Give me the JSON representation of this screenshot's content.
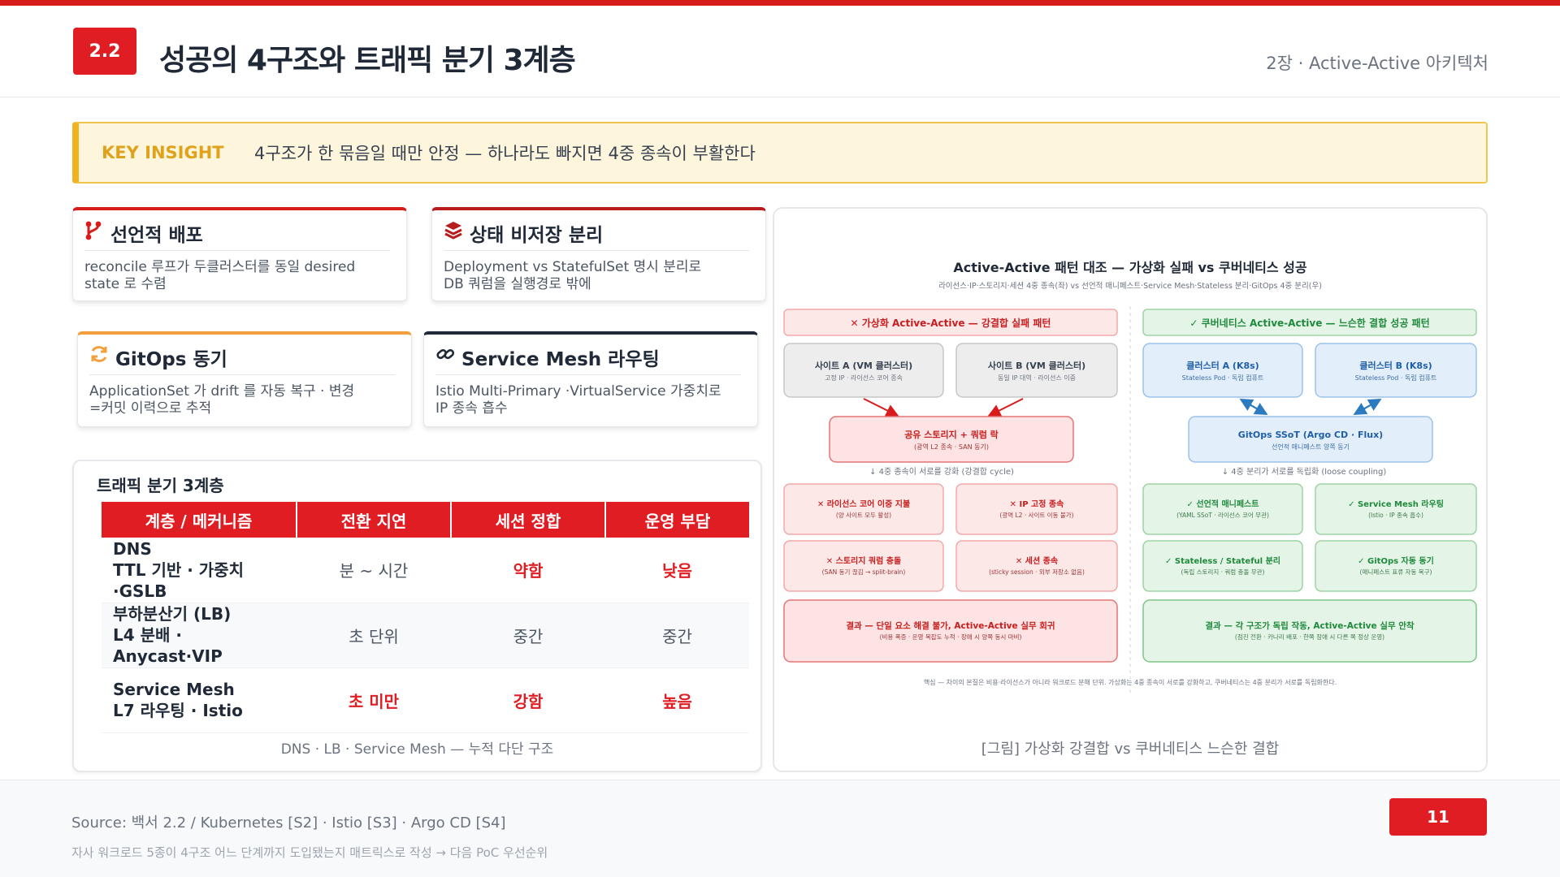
{
  "header": {
    "badge": "2.2",
    "title": "성공의 4구조와 트래픽 분기 3계층",
    "chapter": "2장 · Active-Active 아키텍처"
  },
  "insight": {
    "label": "KEY INSIGHT",
    "text": "4구조가 한 묶음일 때만 안정 — 하나라도 빠지면 4중 종속이 부활한다"
  },
  "cards": [
    {
      "title": "선언적 배포",
      "icon": "branch-icon",
      "accent": "#d81b1b",
      "lines": [
        "reconcile 루프가 두클러스터를 동일 desired",
        "state 로 수렴"
      ]
    },
    {
      "title": "상태 비저장 분리",
      "icon": "layers-icon",
      "accent": "#b91c1c",
      "lines": [
        "Deployment vs StatefulSet 명시 분리로",
        "DB 쿼럼을 실행경로 밖에"
      ]
    },
    {
      "title": "GitOps 동기",
      "icon": "sync-icon",
      "accent": "#f2a03d",
      "lines": [
        "ApplicationSet 가 drift 를 자동 복구 · 변경",
        "=커밋 이력으로 추적"
      ]
    },
    {
      "title": "Service Mesh 라우팅",
      "icon": "link-icon",
      "accent": "#1f2937",
      "lines": [
        "Istio Multi-Primary ·VirtualService 가중치로",
        "IP 종속 흡수"
      ]
    }
  ],
  "traffic": {
    "title": "트래픽 분기 3계층",
    "headers": [
      "계층 / 메커니즘",
      "전환 지연",
      "세션 정합",
      "운영 부담"
    ],
    "rows": [
      {
        "mech1": "DNS",
        "mech2": "TTL 기반 · 가중치·GSLB",
        "latency": "분 ~ 시간",
        "session": "약함",
        "burden": "낮음",
        "hl": [
          false,
          true,
          true
        ]
      },
      {
        "mech1": "부하분산기 (LB)",
        "mech2": "L4 분배 · Anycast·VIP",
        "latency": "초 단위",
        "session": "중간",
        "burden": "중간",
        "hl": [
          false,
          false,
          false
        ]
      },
      {
        "mech1": "Service Mesh",
        "mech2": "L7 라우팅 · Istio",
        "latency": "초 미만",
        "session": "강함",
        "burden": "높음",
        "hl": [
          true,
          true,
          true
        ]
      }
    ],
    "caption": "DNS · LB · Service Mesh — 누적 다단 구조"
  },
  "figure": {
    "title": "Active-Active 패턴 대조 — 가상화 실패 vs 쿠버네티스 성공",
    "subtitle": "라이선스·IP·스토리지·세션 4중 종속(좌) vs 선언적 매니페스트·Service Mesh·Stateless 분리·GitOps 4중 분리(우)",
    "left": {
      "header": "✕ 가상화 Active-Active — 강결합 실패 패턴",
      "site_a": {
        "t": "사이트 A (VM 클러스터)",
        "s": "고정 IP · 라이선스 코어 종속"
      },
      "site_b": {
        "t": "사이트 B (VM 클러스터)",
        "s": "동일 IP 대역 · 라이선스 이중"
      },
      "shared": {
        "t": "공유 스토리지 + 쿼럼 락",
        "s": "(광역 L2 종속 · SAN 동기)"
      },
      "note": "↓ 4중 종속이 서로를 강화 (강결합 cycle)",
      "items": [
        {
          "t": "✕ 라이선스 코어 이중 지불",
          "s": "(양 사이트 모두 활성)"
        },
        {
          "t": "✕ IP 고정 종속",
          "s": "(광역 L2 · 사이트 이동 불가)"
        },
        {
          "t": "✕ 스토리지 쿼럼 충돌",
          "s": "(SAN 동기 끊김 → split-brain)"
        },
        {
          "t": "✕ 세션 종속",
          "s": "(sticky session · 외부 저장소 없음)"
        }
      ],
      "result": {
        "t": "결과 — 단일 요소 해결 불가, Active-Active 실무 회귀",
        "s": "(비용 폭증 · 운영 복잡도 누적 · 장애 시 양쪽 동시 마비)"
      }
    },
    "right": {
      "header": "✓ 쿠버네티스 Active-Active — 느슨한 결합 성공 패턴",
      "site_a": {
        "t": "클러스터 A (K8s)",
        "s": "Stateless Pod · 독립 컴퓨트"
      },
      "site_b": {
        "t": "클러스터 B (K8s)",
        "s": "Stateless Pod · 독립 컴퓨트"
      },
      "shared": {
        "t": "GitOps SSoT (Argo CD · Flux)",
        "s": "선언적 매니페스트 양쪽 동기"
      },
      "note": "↓ 4중 분리가 서로를 독립화 (loose coupling)",
      "items": [
        {
          "t": "✓ 선언적 매니페스트",
          "s": "(YAML SSoT · 라이선스 코어 무관)"
        },
        {
          "t": "✓ Service Mesh 라우팅",
          "s": "(Istio · IP 종속 흡수)"
        },
        {
          "t": "✓ Stateless / Stateful 분리",
          "s": "(독립 스토리지 · 쿼럼 충돌 무관)"
        },
        {
          "t": "✓ GitOps 자동 동기",
          "s": "(매니페스트 표류 자동 복구)"
        }
      ],
      "result": {
        "t": "결과 — 각 구조가 독립 작동, Active-Active 실무 안착",
        "s": "(점진 전환 · 카나리 배포 · 한쪽 장애 시 다른 쪽 정상 운영)"
      }
    },
    "footnote": "핵심 — 차이의 본질은 비용·라이선스가 아니라 워크로드 분해 단위. 가상화는 4중 종속이 서로를 강화하고, 쿠버네티스는 4중 분리가 서로를 독립화한다.",
    "caption": "[그림] 가상화 강결합 vs 쿠버네티스 느슨한 결합"
  },
  "footer": {
    "source": "Source: 백서 2.2 / Kubernetes [S2] · Istio [S3] · Argo CD [S4]",
    "note": "자사 워크로드 5종이 4구조 어느 단계까지 도입됐는지 매트릭스로 작성 → 다음 PoC 우선순위",
    "page": "11"
  }
}
